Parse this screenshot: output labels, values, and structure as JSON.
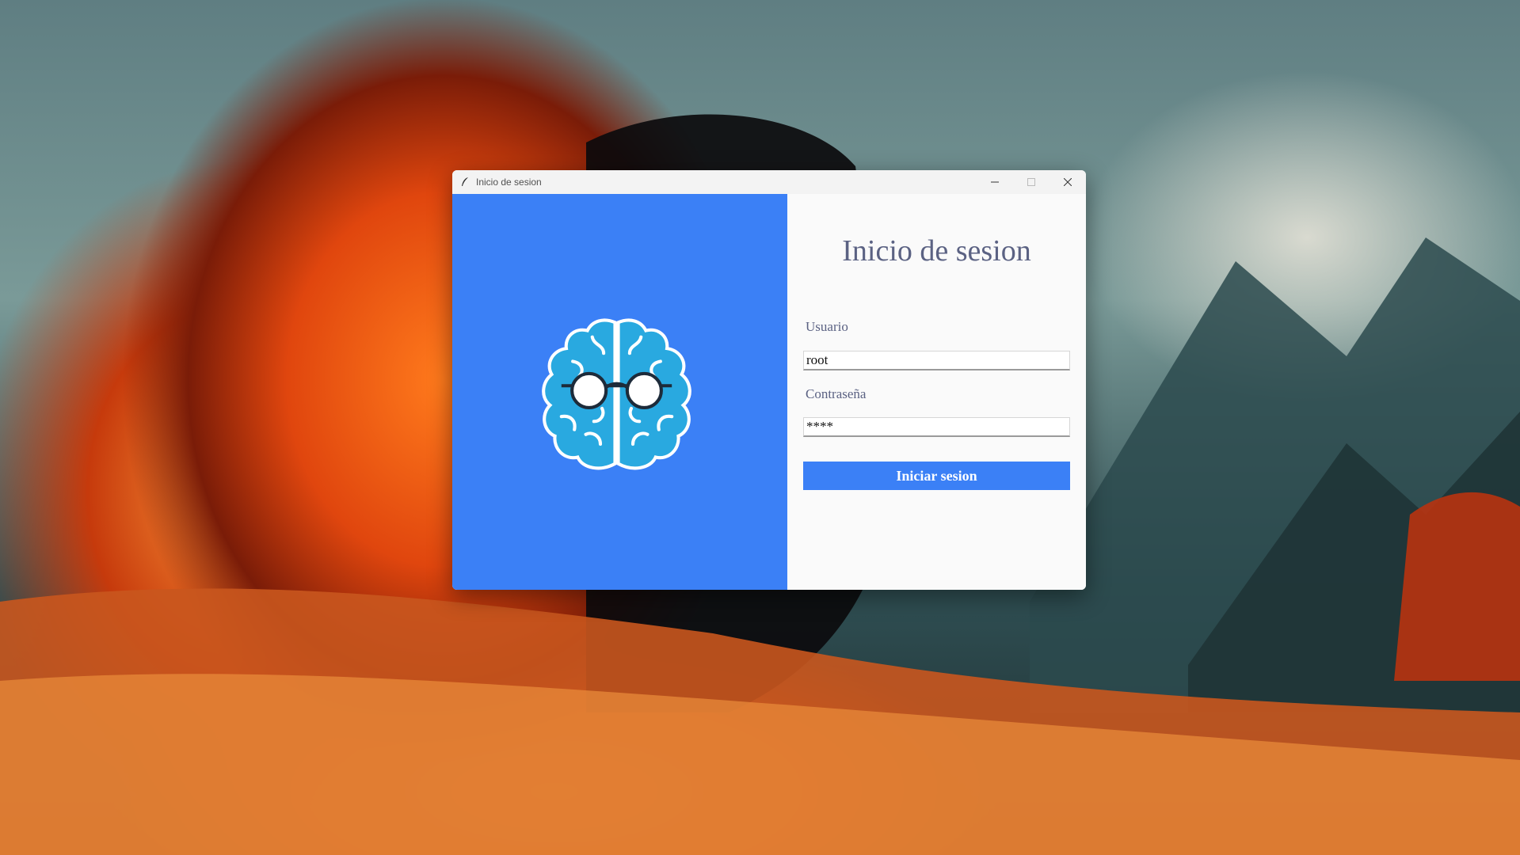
{
  "window": {
    "title": "Inicio de sesion",
    "icon": "feather-icon",
    "controls": [
      "minimize-icon",
      "maximize-icon",
      "close-icon"
    ]
  },
  "left_panel": {
    "background": "#3b80f6",
    "logo_icon": "brain-with-glasses-icon"
  },
  "form": {
    "heading": "Inicio de sesion",
    "username_label": "Usuario",
    "username_value": "root",
    "password_label": "Contraseña",
    "password_value": "****",
    "submit_label": "Iniciar sesion"
  },
  "colors": {
    "accent": "#3b80f6",
    "text": "#5b6283",
    "brain": "#29a9e0"
  }
}
